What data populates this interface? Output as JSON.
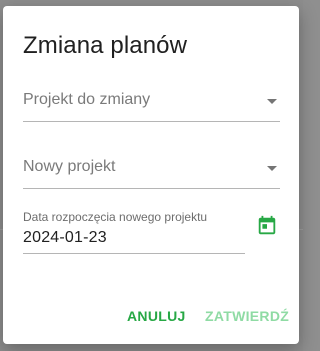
{
  "dialog": {
    "title": "Zmiana planów",
    "project_select": {
      "placeholder": "Projekt do zmiany"
    },
    "new_project_select": {
      "placeholder": "Nowy projekt"
    },
    "start_date": {
      "label": "Data rozpoczęcia nowego projektu",
      "value": "2024-01-23"
    },
    "actions": {
      "cancel_label": "ANULUJ",
      "confirm_label": "ZATWIERDŹ"
    }
  },
  "colors": {
    "accent": "#27a845",
    "accent_disabled": "#8fdba4"
  },
  "icons": {
    "date_picker": "calendar-icon",
    "dropdown": "chevron-down-icon"
  }
}
